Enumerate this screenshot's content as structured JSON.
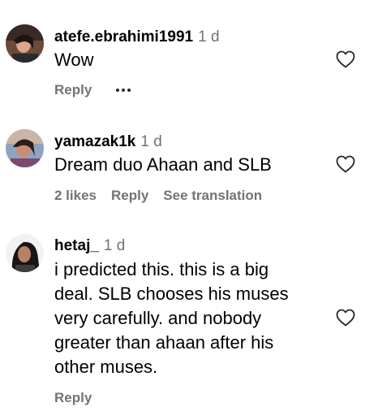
{
  "comments": [
    {
      "username": "atefe.ebrahimi1991",
      "time": "1 d",
      "text": "Wow",
      "actions": {
        "reply": "Reply"
      },
      "more_icon": "ellipsis-icon",
      "like_icon": "heart-outline-icon"
    },
    {
      "username": "yamazak1k",
      "time": "1 d",
      "text": "Dream duo Ahaan and SLB",
      "actions": {
        "likes": "2 likes",
        "reply": "Reply",
        "translate": "See translation"
      },
      "like_icon": "heart-outline-icon"
    },
    {
      "username": "hetaj_",
      "time": "1 d",
      "text_lines": [
        "i predicted this. this is a big",
        "deal. SLB chooses his muses",
        "very carefully. and nobody",
        "greater than ahaan after his",
        "other muses."
      ],
      "actions": {
        "reply": "Reply"
      },
      "like_icon": "heart-outline-icon"
    }
  ],
  "colors": {
    "primary_text": "#000000",
    "secondary_text": "#737373",
    "icon": "#262626"
  }
}
